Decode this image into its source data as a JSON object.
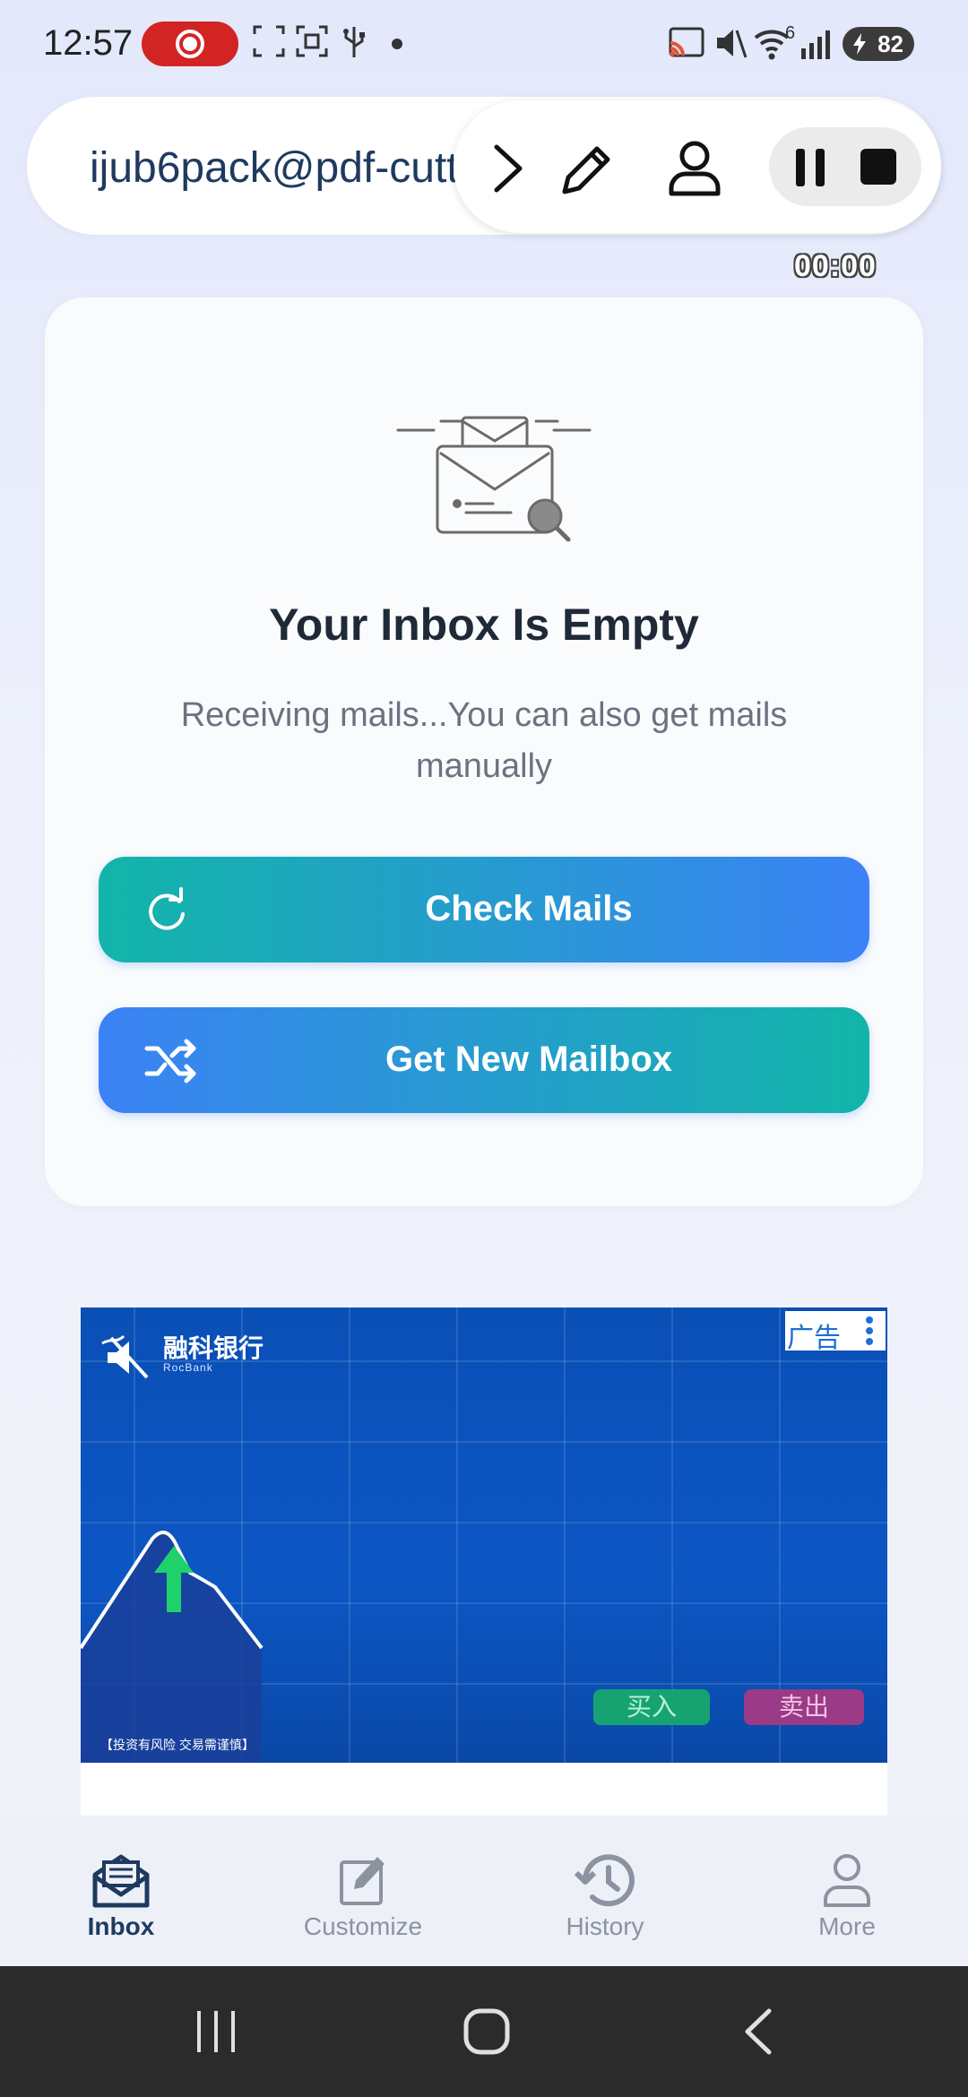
{
  "status_bar": {
    "time": "12:57",
    "battery": "82",
    "network_badge": "6",
    "icons": [
      "screen-record-icon",
      "screenshot-crop-icon",
      "scan-icon",
      "usb-icon",
      "dot-icon",
      "cast-icon",
      "mute-icon",
      "wifi-icon",
      "signal-icon",
      "battery-icon"
    ],
    "rec_color": "#d32424"
  },
  "header": {
    "email": "ijub6pack@pdf-cutt",
    "timer": "00:00",
    "toolbar_icons": [
      "chevron-right-icon",
      "pencil-icon",
      "person-icon",
      "pause-icon",
      "stop-icon"
    ]
  },
  "empty_state": {
    "title": "Your Inbox Is Empty",
    "subtitle": "Receiving mails...You can also get mails manually",
    "icon": "empty-inbox-illustration"
  },
  "actions": {
    "check_mails": "Check Mails",
    "get_new_mailbox": "Get New Mailbox",
    "gradient_start": "#12b5a8",
    "gradient_end": "#3b82f6"
  },
  "ad": {
    "tag": "广告",
    "brand": "融科银行",
    "brand_en": "RocBank",
    "buy": "买入",
    "sell": "卖出",
    "disclaimer": "【投资有风险 交易需谨慎】",
    "background": "#0a4fb6"
  },
  "bottom_nav": {
    "items": [
      {
        "label": "Inbox",
        "icon": "inbox-icon",
        "active": true
      },
      {
        "label": "Customize",
        "icon": "edit-icon",
        "active": false
      },
      {
        "label": "History",
        "icon": "history-icon",
        "active": false
      },
      {
        "label": "More",
        "icon": "person-icon",
        "active": false
      }
    ]
  },
  "system_nav": [
    "recents-icon",
    "home-icon",
    "back-icon"
  ]
}
